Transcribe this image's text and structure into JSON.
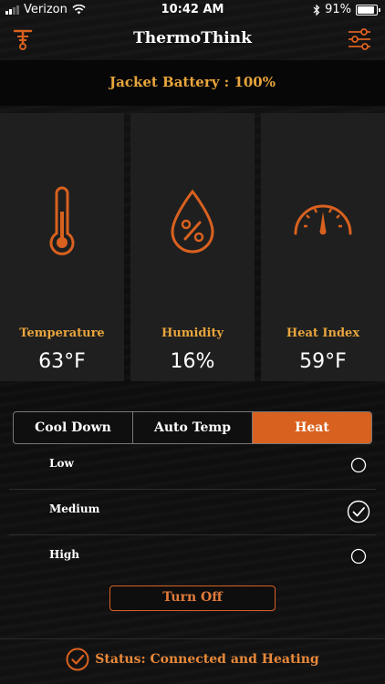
{
  "status_bar": {
    "carrier": "Verizon",
    "time": "10:42 AM",
    "battery_percent": "91%"
  },
  "nav": {
    "title": "ThermoThink",
    "left_icon": "thermo-logo-icon",
    "right_icon": "settings-sliders-icon"
  },
  "banner": {
    "text": "Jacket Battery : 100%"
  },
  "cards": [
    {
      "label": "Temperature",
      "value": "63°F",
      "icon": "thermometer-icon"
    },
    {
      "label": "Humidity",
      "value": "16%",
      "icon": "humidity-drop-icon"
    },
    {
      "label": "Heat Index",
      "value": "59°F",
      "icon": "gauge-icon"
    }
  ],
  "modes": {
    "items": [
      "Cool Down",
      "Auto Temp",
      "Heat"
    ],
    "selected": "Heat"
  },
  "levels": {
    "items": [
      {
        "label": "Low",
        "checked": false
      },
      {
        "label": "Medium",
        "checked": true
      },
      {
        "label": "High",
        "checked": false
      }
    ]
  },
  "actions": {
    "turn_off": "Turn Off"
  },
  "status": {
    "text": "Status: Connected and Heating"
  },
  "colors": {
    "accent": "#d9611f",
    "gold": "#e8a53c",
    "card_bg": "#1f1f1f"
  }
}
